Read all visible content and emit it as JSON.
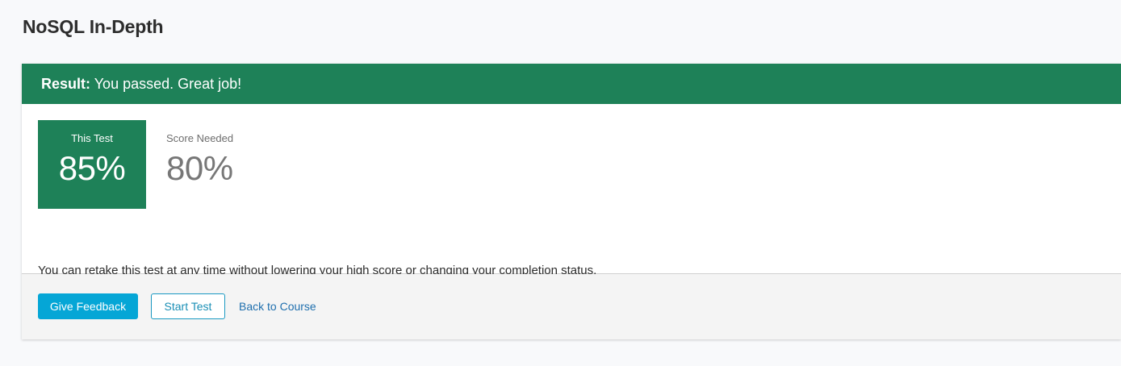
{
  "page": {
    "title": "NoSQL In-Depth"
  },
  "result": {
    "label": "Result:",
    "message": "You passed. Great job!",
    "accent_color": "#1e8158"
  },
  "scores": {
    "this_test": {
      "label": "This Test",
      "value": "85%"
    },
    "score_needed": {
      "label": "Score Needed",
      "value": "80%"
    }
  },
  "note": "You can retake this test at any time without lowering your high score or changing your completion status.",
  "actions": {
    "give_feedback": "Give Feedback",
    "start_test": "Start Test",
    "back_to_course": "Back to Course"
  },
  "colors": {
    "primary_button": "#05a6d6",
    "link": "#1f6fae"
  }
}
